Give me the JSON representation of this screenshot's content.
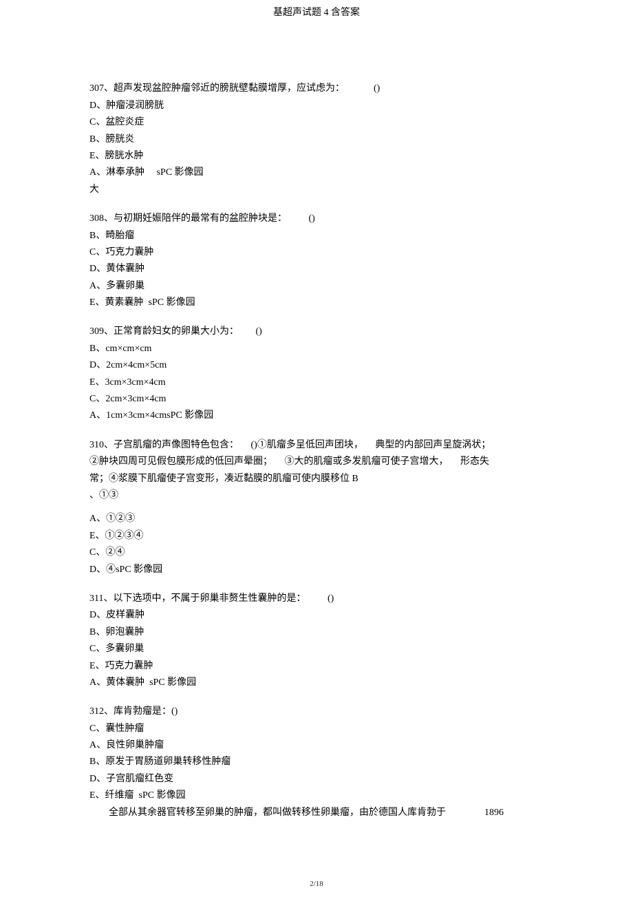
{
  "header": {
    "title": "基超声试题 4 含答案"
  },
  "q307": {
    "stem": "307、超声发现盆腔肿瘤邻近的膀胱壁黏膜增厚，应试虑为：            ()",
    "lines": [
      "D、肿瘤浸润膀胱",
      "C、盆腔炎症",
      "B、膀胱炎",
      "E、膀胱水肿",
      "A、淋奉承肿     sPC 影像园",
      "大"
    ]
  },
  "q308": {
    "stem": "308、与初期妊娠陪伴的最常有的盆腔肿块是：         ()",
    "lines": [
      "B、畸胎瘤",
      "C、巧克力囊肿",
      "D、黄体囊肿",
      "A、多囊卵巢",
      "E、黄素囊肿  sPC 影像园"
    ]
  },
  "q309": {
    "stem": "309、正常育龄妇女的卵巢大小为：       ()",
    "lines": [
      "B、cm×cm×cm",
      "D、2cm×4cm×5cm",
      "E、3cm×3cm×4cm",
      "C、2cm×3cm×4cm",
      "A、1cm×3cm×4cmsPC 影像园"
    ]
  },
  "q310": {
    "stemLines": [
      "310、子宫肌瘤的声像图特色包含：     ()①肌瘤多呈低回声团块，     典型的内部回声呈旋涡状；",
      "②肿块四周可见假包膜形成的低回声晕圈；     ③大的肌瘤或多发肌瘤可使子宫增大，     形态失",
      "常；④浆膜下肌瘤使子宫变形，凑近黏膜的肌瘤可使内膜移位 B",
      "、①③"
    ],
    "lines": [
      "A、①②③",
      "E、①②③④",
      "C、②④",
      "D、④sPC 影像园"
    ]
  },
  "q311": {
    "stem": "311、以下选项中，不属于卵巢非赘生性囊肿的是：         ()",
    "lines": [
      "D、皮样囊肿",
      "B、卵泡囊肿",
      "C、多囊卵巢",
      "E、巧克力囊肿",
      "A、黄体囊肿  sPC 影像园"
    ]
  },
  "q312": {
    "stem": "312、库肯勃瘤是：()",
    "lines": [
      "C、囊性肿瘤",
      "A、良性卵巢肿瘤",
      "B、原发于胃肠道卵巢转移性肿瘤",
      "D、子宫肌瘤红色变",
      "E、纤维瘤  sPC 影像园"
    ],
    "footnote": "全部从其余器官转移至卵巢的肿瘤，都叫做转移性卵巢瘤，由於德国人库肯勃于                1896"
  },
  "pagenum": "2/18"
}
